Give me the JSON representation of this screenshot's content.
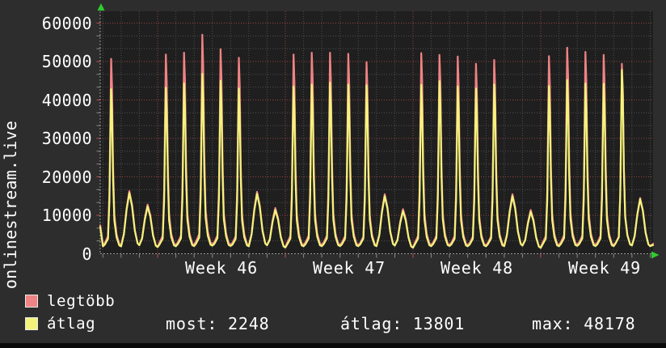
{
  "window": {
    "background": "#2d2d2d",
    "plot_background": "#1f1f1f",
    "text_color": "#ffffff",
    "arrow_color": "#2ecc2e"
  },
  "chart_data": {
    "type": "line",
    "title": "onlinestream.live",
    "xlabel": "",
    "ylabel": "onlinestream.live",
    "ylim": [
      0,
      63000
    ],
    "y_major": 10000,
    "y_minor_fraction": 3,
    "grid": {
      "major_color": "#964242",
      "minor_color": "#4f4f4f",
      "axis_color": "#9a9a9a",
      "week_tick_color": "#c05050",
      "day_tick_color": "#8a8a8a"
    },
    "legend_position": "bottom-left",
    "y_tick_labels": [
      "0",
      "10000",
      "20000",
      "30000",
      "40000",
      "50000",
      "60000"
    ],
    "x_tick_labels": [
      "Week 46",
      "Week 47",
      "Week 48",
      "Week 49"
    ],
    "x_unit": "day",
    "days_per_week": 7,
    "day_types": [
      "wd",
      "we",
      "we",
      "wd",
      "wd",
      "wd",
      "wd",
      "wd",
      "we",
      "we",
      "wd",
      "wd",
      "wd",
      "wd",
      "wd",
      "we",
      "we",
      "wd",
      "wd",
      "wd",
      "wd",
      "wd",
      "we",
      "we",
      "wd",
      "wd",
      "wd",
      "wd",
      "wd",
      "we"
    ],
    "profiles": {
      "wd": [
        [
          0,
          0.045
        ],
        [
          0.1,
          0.055
        ],
        [
          0.28,
          0.09
        ],
        [
          0.36,
          0.32
        ],
        [
          0.4,
          0.62
        ],
        [
          0.45,
          1
        ],
        [
          0.5,
          0.86
        ],
        [
          0.56,
          0.45
        ],
        [
          0.63,
          0.2
        ],
        [
          0.75,
          0.1
        ],
        [
          0.9,
          0.05
        ],
        [
          1,
          0.045
        ]
      ],
      "we": [
        [
          0,
          0.14
        ],
        [
          0.15,
          0.32
        ],
        [
          0.3,
          0.72
        ],
        [
          0.45,
          1
        ],
        [
          0.6,
          0.78
        ],
        [
          0.75,
          0.38
        ],
        [
          0.9,
          0.17
        ],
        [
          1,
          0.14
        ]
      ]
    },
    "series": [
      {
        "name": "legtöbb",
        "role": "max",
        "color": "#f08383",
        "edge": {
          "start": 7400,
          "end": 2600
        },
        "day_peaks": [
          50700,
          16300,
          12800,
          51800,
          52300,
          57000,
          53200,
          51000,
          16100,
          11900,
          51800,
          52300,
          52300,
          52000,
          49800,
          15500,
          11600,
          52200,
          51700,
          51300,
          49400,
          50400,
          15500,
          11400,
          51400,
          53600,
          52500,
          51700,
          49400,
          14500
        ]
      },
      {
        "name": "átlag",
        "role": "avg",
        "color": "#f3f37c",
        "edge": {
          "start": 7000,
          "end": 2248
        },
        "day_peaks": [
          42800,
          15800,
          12300,
          43200,
          44300,
          46800,
          45000,
          43000,
          15600,
          11400,
          43500,
          44000,
          44500,
          44000,
          43800,
          15000,
          11100,
          43900,
          44900,
          43500,
          43000,
          44000,
          15000,
          10900,
          43600,
          45200,
          44300,
          44200,
          47800,
          14200
        ]
      }
    ],
    "stats": {
      "most": 2248,
      "atlag": 13801,
      "max": 48178
    }
  },
  "footer": {
    "legend": [
      {
        "label": "legtöbb"
      },
      {
        "label": "átlag"
      }
    ],
    "stats": [
      "most: 2248",
      "átlag: 13801",
      "max: 48178"
    ]
  }
}
